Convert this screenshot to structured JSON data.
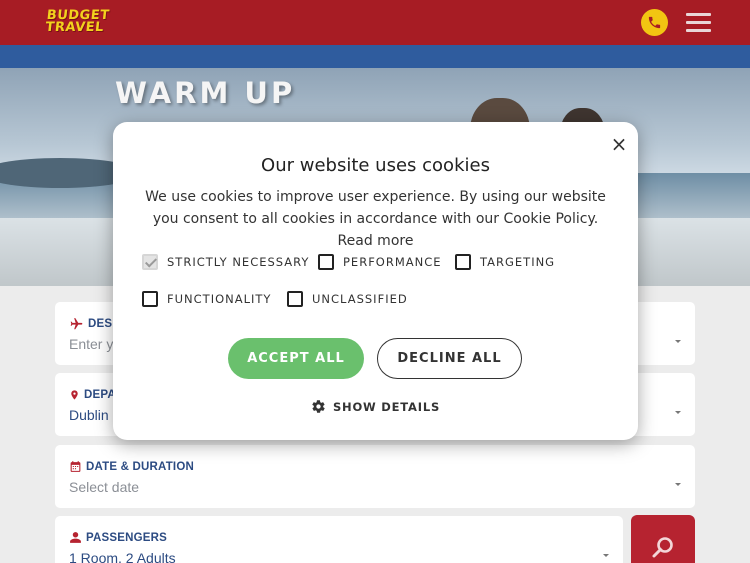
{
  "header": {
    "logo_line1": "BUDGET",
    "logo_line2": "TRAVEL",
    "phone_icon": "phone-icon",
    "menu_icon": "hamburger-menu-icon"
  },
  "hero": {
    "title": "WARM UP"
  },
  "search": {
    "destination": {
      "label": "DES",
      "value": "Enter y",
      "icon": "airplane-icon"
    },
    "departure": {
      "label": "DEPA",
      "value": "Dublin",
      "icon": "map-pin-icon"
    },
    "date": {
      "label": "DATE & DURATION",
      "value": "Select date",
      "icon": "calendar-icon"
    },
    "passengers": {
      "label": "PASSENGERS",
      "value": "1 Room, 2 Adults",
      "icon": "user-icon"
    },
    "search_icon": "search-icon"
  },
  "cookie_modal": {
    "title": "Our website uses cookies",
    "description": "We use cookies to improve user experience. By using our website you consent to all cookies in accordance with our Cookie Policy.",
    "read_more": "Read more",
    "options": [
      {
        "label": "STRICTLY NECESSARY",
        "checked": true
      },
      {
        "label": "PERFORMANCE",
        "checked": false
      },
      {
        "label": "TARGETING",
        "checked": false
      },
      {
        "label": "FUNCTIONALITY",
        "checked": false
      },
      {
        "label": "UNCLASSIFIED",
        "checked": false
      }
    ],
    "accept_label": "ACCEPT ALL",
    "decline_label": "DECLINE ALL",
    "show_details_label": "SHOW DETAILS",
    "close_symbol": "×"
  },
  "colors": {
    "header_red": "#a71c24",
    "logo_yellow": "#f2d21d",
    "blue_bar": "#2f5c9e",
    "accept_green": "#6ac06d",
    "label_blue": "#2c4b82",
    "search_red": "#b62330"
  }
}
